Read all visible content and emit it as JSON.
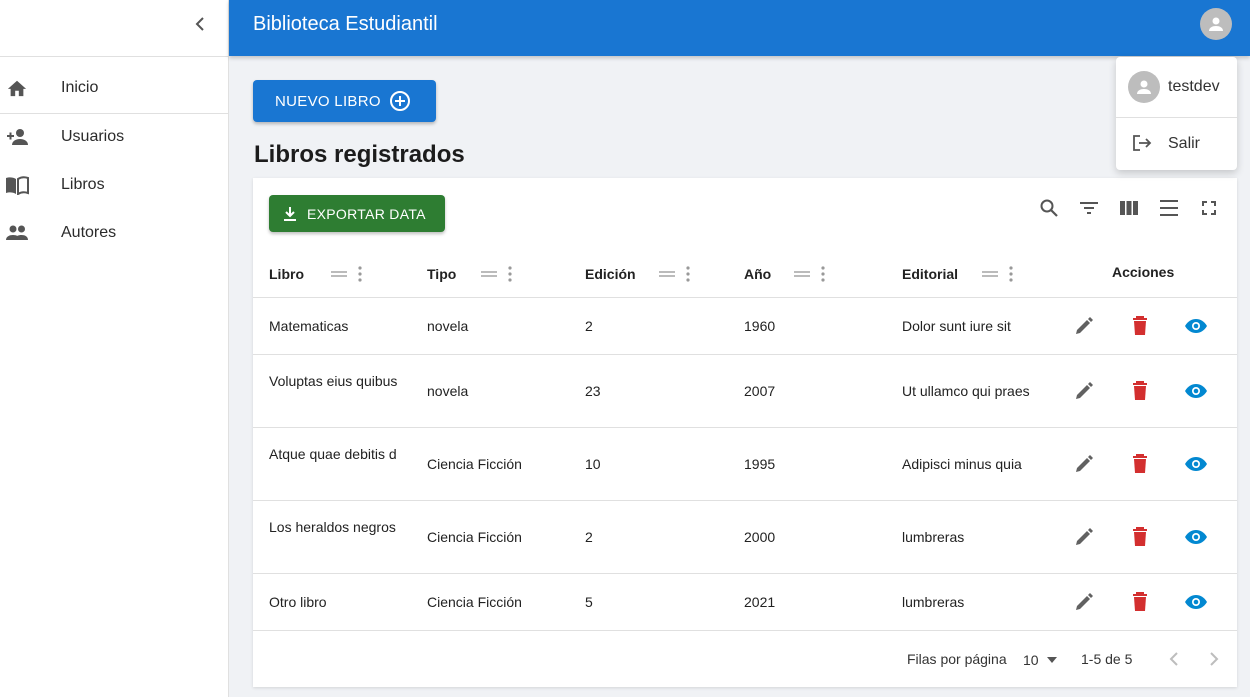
{
  "app": {
    "title": "Biblioteca Estudiantil",
    "primary_color": "#1976d2"
  },
  "sidebar": {
    "collapse_icon": "chevron-left-icon",
    "items": [
      {
        "label": "Inicio",
        "icon": "home-icon"
      },
      {
        "label": "Usuarios",
        "icon": "person-add-icon"
      },
      {
        "label": "Libros",
        "icon": "book-open-icon"
      },
      {
        "label": "Autores",
        "icon": "people-icon"
      }
    ]
  },
  "user_menu": {
    "username": "testdev",
    "logout_label": "Salir"
  },
  "main": {
    "new_button_label": "NUEVO LIBRO",
    "page_title": "Libros registrados",
    "export_button_label": "EXPORTAR DATA",
    "toolbar_icons": [
      "search-icon",
      "filter-icon",
      "columns-icon",
      "density-icon",
      "fullscreen-icon"
    ],
    "columns": [
      "Libro",
      "Tipo",
      "Edición",
      "Año",
      "Editorial",
      "Acciones"
    ],
    "rows": [
      {
        "libro": "Matematicas",
        "tipo": "novela",
        "edicion": "2",
        "anio": "1960",
        "editorial": "Dolor sunt iure sit"
      },
      {
        "libro": "Voluptas eius quibus",
        "tipo": "novela",
        "edicion": "23",
        "anio": "2007",
        "editorial": "Ut ullamco qui praes"
      },
      {
        "libro": "Atque quae debitis d",
        "tipo": "Ciencia Ficción",
        "edicion": "10",
        "anio": "1995",
        "editorial": "Adipisci minus quia"
      },
      {
        "libro": "Los heraldos negros",
        "tipo": "Ciencia Ficción",
        "edicion": "2",
        "anio": "2000",
        "editorial": "lumbreras"
      },
      {
        "libro": "Otro libro",
        "tipo": "Ciencia Ficción",
        "edicion": "5",
        "anio": "2021",
        "editorial": "lumbreras"
      }
    ],
    "action_colors": {
      "edit": "#616161",
      "delete": "#d32f2f",
      "view": "#0288d1"
    },
    "pagination": {
      "rows_per_page_label": "Filas por página",
      "rows_per_page_value": "10",
      "range": "1-5 de 5"
    }
  }
}
